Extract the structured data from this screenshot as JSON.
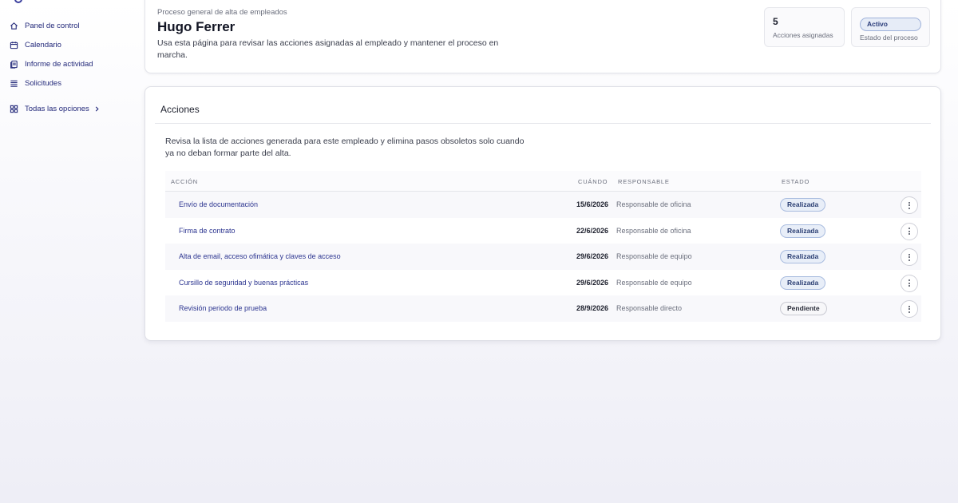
{
  "sidebar": {
    "items": [
      {
        "label": "Panel de control",
        "icon": "home-icon"
      },
      {
        "label": "Calendario",
        "icon": "calendar-icon"
      },
      {
        "label": "Informe de actividad",
        "icon": "document-icon"
      },
      {
        "label": "Solicitudes",
        "icon": "list-icon"
      }
    ],
    "all_options": {
      "label": "Todas las opciones",
      "icon": "grid-icon"
    }
  },
  "header": {
    "kicker": "Proceso general de alta de empleados",
    "name": "Hugo Ferrer",
    "description": "Usa esta página para revisar las acciones asignadas al empleado y mantener el proceso en marcha.",
    "stats": {
      "assigned_count": "5",
      "assigned_label": "Acciones asignadas",
      "status_value": "Activo",
      "status_label": "Estado del proceso"
    }
  },
  "actions": {
    "title": "Acciones",
    "intro": "Revisa la lista de acciones generada para este empleado y elimina pasos obsoletos solo cuando ya no deban formar parte del alta.",
    "columns": {
      "action": "ACCIÓN",
      "when": "CUÁNDO",
      "owner": "RESPONSABLE",
      "state": "ESTADO"
    },
    "rows": [
      {
        "action": "Envío de documentación",
        "when": "15/6/2026",
        "owner": "Responsable de oficina",
        "state": "Realizada"
      },
      {
        "action": "Firma de contrato",
        "when": "22/6/2026",
        "owner": "Responsable de oficina",
        "state": "Realizada"
      },
      {
        "action": "Alta de email, acceso ofimática y claves de acceso",
        "when": "29/6/2026",
        "owner": "Responsable de equipo",
        "state": "Realizada"
      },
      {
        "action": "Cursillo de seguridad y buenas prácticas",
        "when": "29/6/2026",
        "owner": "Responsable de equipo",
        "state": "Realizada"
      },
      {
        "action": "Revisión periodo de prueba",
        "when": "28/9/2026",
        "owner": "Responsable directo",
        "state": "Pendiente"
      }
    ]
  },
  "colors": {
    "accent": "#23297a",
    "link": "#2c3590",
    "done_badge_bg": "#e8eef8",
    "pending_badge_bg": "#f7f7f9"
  }
}
